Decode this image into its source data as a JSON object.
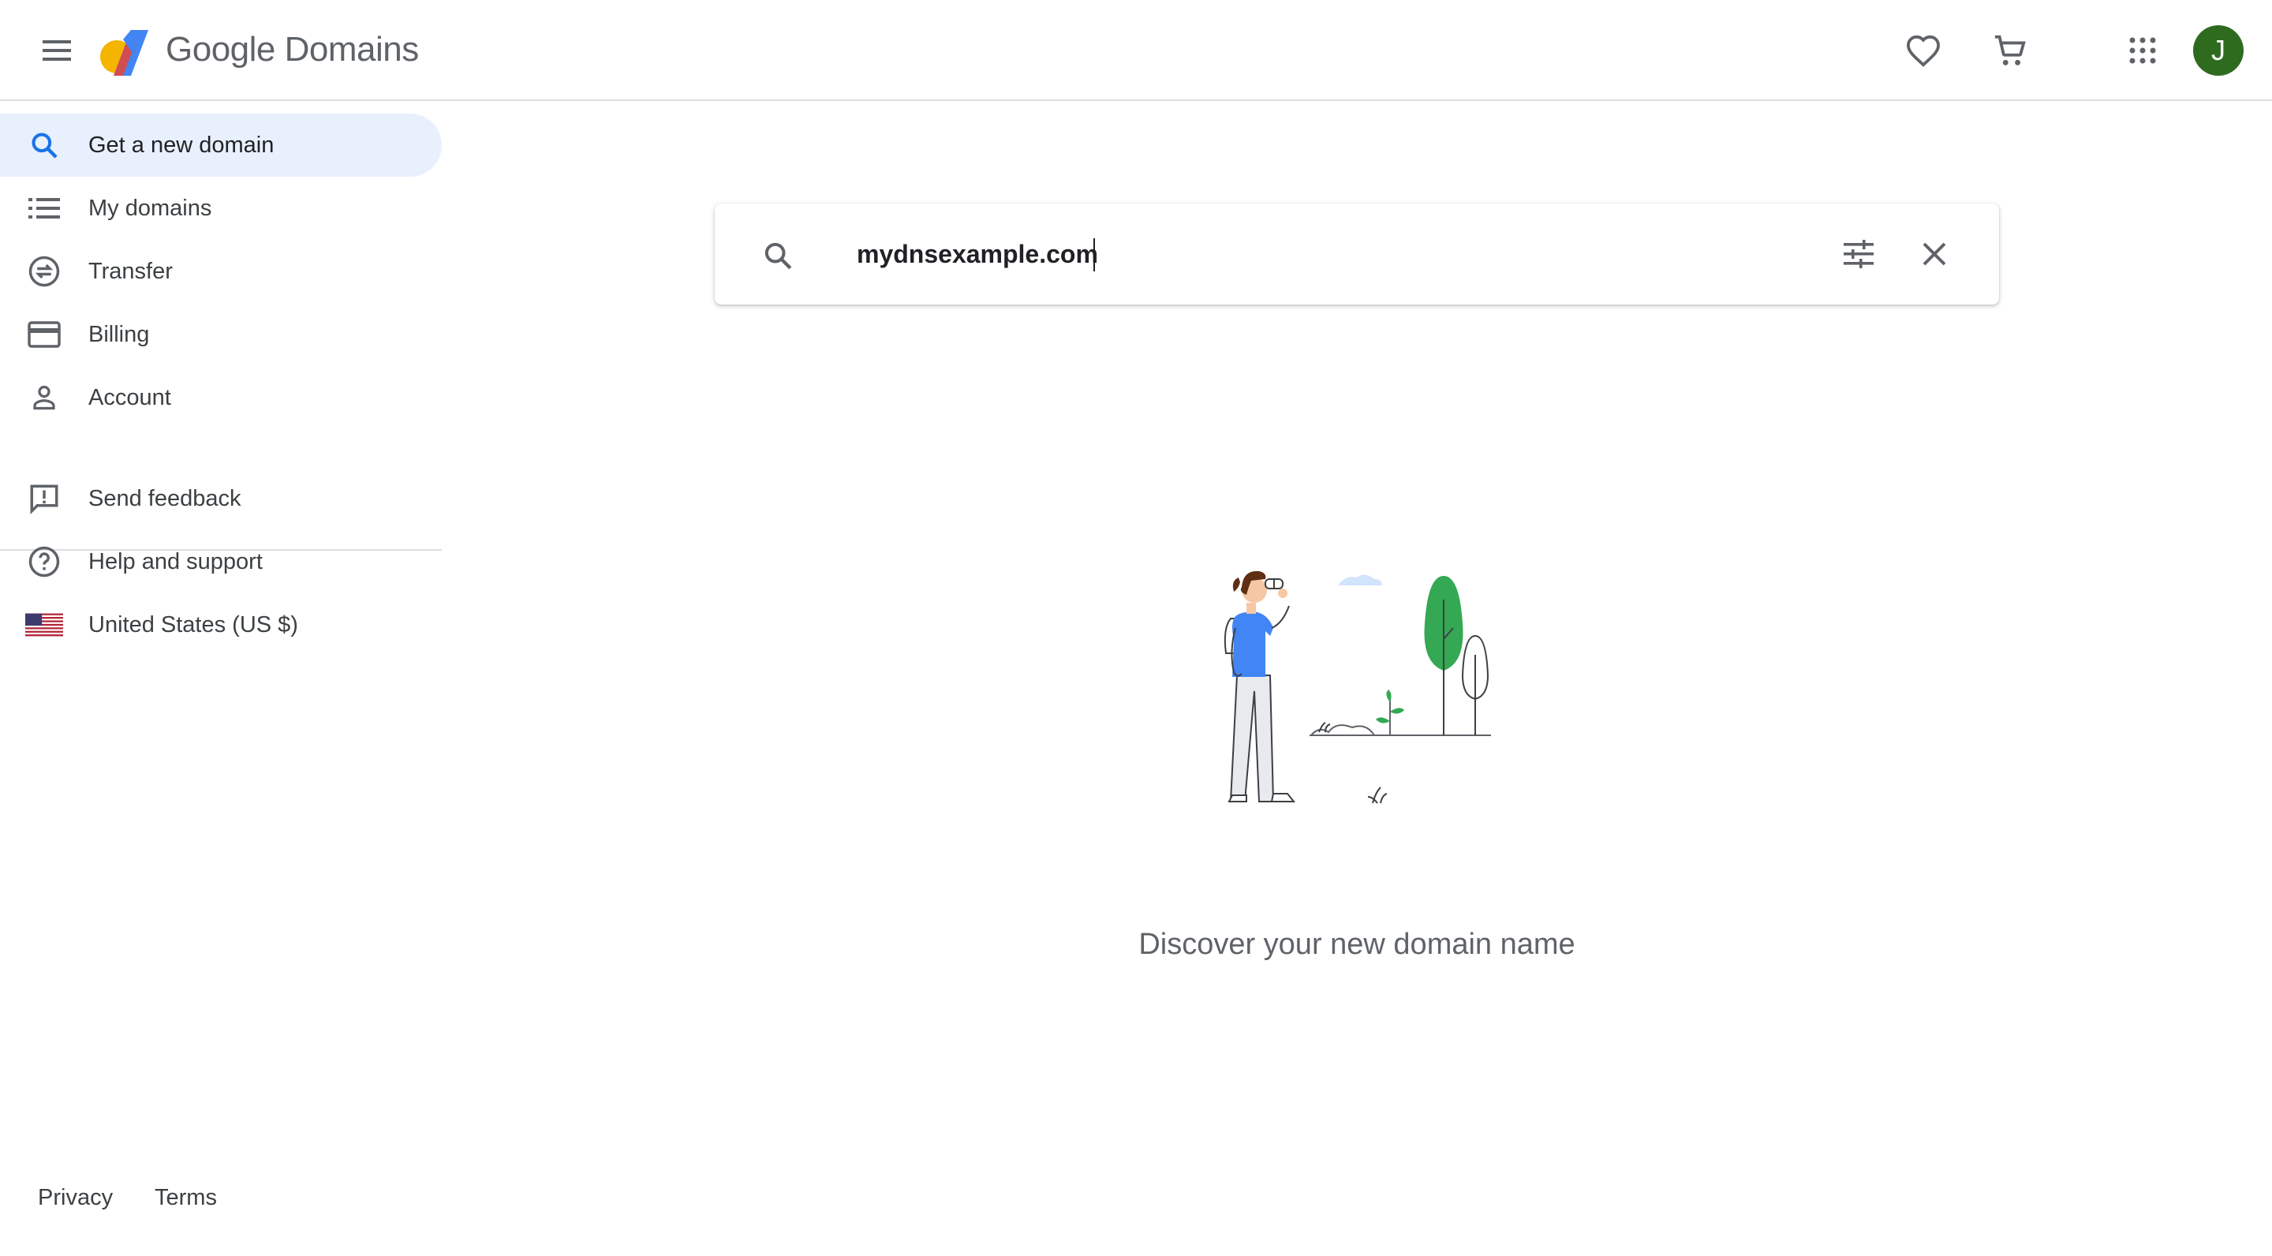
{
  "header": {
    "brand_google": "Google",
    "brand_product": "Domains",
    "avatar_initial": "J",
    "icons": [
      "menu-icon",
      "favorite-icon",
      "cart-icon",
      "apps-icon"
    ]
  },
  "sidebar": {
    "items": [
      {
        "label": "Get a new domain",
        "icon": "search-icon",
        "active": true
      },
      {
        "label": "My domains",
        "icon": "list-icon",
        "active": false
      },
      {
        "label": "Transfer",
        "icon": "transfer-icon",
        "active": false
      },
      {
        "label": "Billing",
        "icon": "credit-card-icon",
        "active": false
      },
      {
        "label": "Account",
        "icon": "person-icon",
        "active": false
      }
    ],
    "secondary": [
      {
        "label": "Send feedback",
        "icon": "feedback-icon"
      },
      {
        "label": "Help and support",
        "icon": "help-icon"
      },
      {
        "label": "United States (US $)",
        "icon": "us-flag-icon"
      }
    ]
  },
  "search": {
    "value": "mydnsexample.com",
    "placeholder": ""
  },
  "main": {
    "discover_text": "Discover your new domain name"
  },
  "footer": {
    "privacy": "Privacy",
    "terms": "Terms"
  },
  "colors": {
    "accent": "#1a73e8",
    "active_bg": "#e8f0fe",
    "avatar_bg": "#2e6b1f",
    "text": "#202124",
    "muted": "#5f6368"
  }
}
